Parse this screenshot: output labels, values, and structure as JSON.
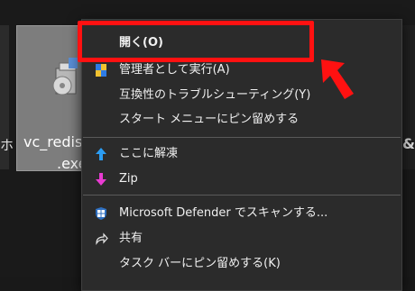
{
  "file": {
    "name_line1": "vc_redis",
    "name_line2": ".exe",
    "left_fragment": "ホ",
    "right_fragment": "&"
  },
  "menu": {
    "items": [
      {
        "label": "開く(O)",
        "icon": "none"
      },
      {
        "label": "管理者として実行(A)",
        "icon": "shield-icon"
      },
      {
        "label": "互換性のトラブルシューティング(Y)",
        "icon": "none"
      },
      {
        "label": "スタート メニューにピン留めする",
        "icon": "none"
      },
      {
        "label": "ここに解凍",
        "icon": "arrow-up-icon"
      },
      {
        "label": "Zip",
        "icon": "arrow-down-icon"
      },
      {
        "label": "Microsoft Defender でスキャンする...",
        "icon": "defender-icon"
      },
      {
        "label": "共有",
        "icon": "share-icon"
      },
      {
        "label": "タスク バーにピン留めする(K)",
        "icon": "none"
      }
    ]
  },
  "colors": {
    "highlight": "#ff1111",
    "menu_bg": "#2b2b2b",
    "zip_arrow_up": "#2b9cf2",
    "zip_arrow_down": "#e83bd1"
  }
}
